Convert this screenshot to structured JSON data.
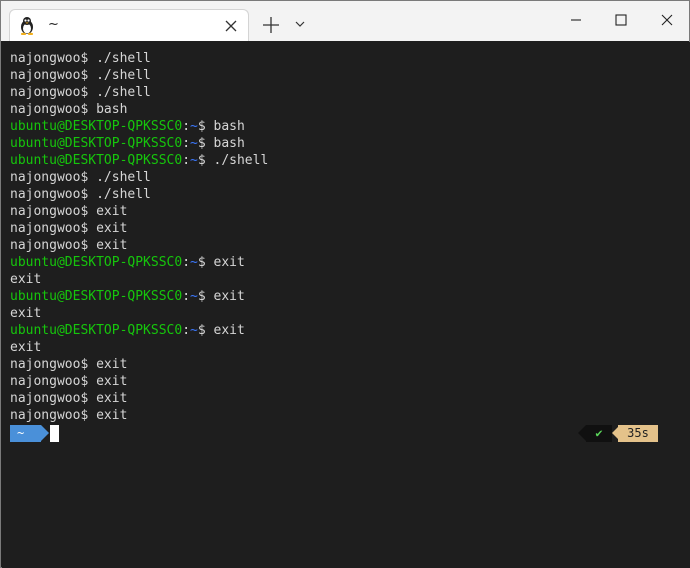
{
  "titlebar": {
    "tab_title": "~",
    "tab_icon": "linux-penguin-icon",
    "new_tab_icon": "plus-icon",
    "dropdown_icon": "chevron-down-icon"
  },
  "terminal": {
    "lines": [
      [
        {
          "text": "najongwoo$ ./shell",
          "c": ""
        }
      ],
      [
        {
          "text": "najongwoo$ ./shell",
          "c": ""
        }
      ],
      [
        {
          "text": "najongwoo$ ./shell",
          "c": ""
        }
      ],
      [
        {
          "text": "najongwoo$ bash",
          "c": ""
        }
      ],
      [
        {
          "text": "ubuntu@DESKTOP-QPKSSC0",
          "c": "green"
        },
        {
          "text": ":",
          "c": ""
        },
        {
          "text": "~",
          "c": "blue"
        },
        {
          "text": "$ bash",
          "c": ""
        }
      ],
      [
        {
          "text": "ubuntu@DESKTOP-QPKSSC0",
          "c": "green"
        },
        {
          "text": ":",
          "c": ""
        },
        {
          "text": "~",
          "c": "blue"
        },
        {
          "text": "$ bash",
          "c": ""
        }
      ],
      [
        {
          "text": "ubuntu@DESKTOP-QPKSSC0",
          "c": "green"
        },
        {
          "text": ":",
          "c": ""
        },
        {
          "text": "~",
          "c": "blue"
        },
        {
          "text": "$ ./shell",
          "c": ""
        }
      ],
      [
        {
          "text": "najongwoo$ ./shell",
          "c": ""
        }
      ],
      [
        {
          "text": "najongwoo$ ./shell",
          "c": ""
        }
      ],
      [
        {
          "text": "najongwoo$ exit",
          "c": ""
        }
      ],
      [
        {
          "text": "najongwoo$ exit",
          "c": ""
        }
      ],
      [
        {
          "text": "najongwoo$ exit",
          "c": ""
        }
      ],
      [
        {
          "text": "ubuntu@DESKTOP-QPKSSC0",
          "c": "green"
        },
        {
          "text": ":",
          "c": ""
        },
        {
          "text": "~",
          "c": "blue"
        },
        {
          "text": "$ exit",
          "c": ""
        }
      ],
      [
        {
          "text": "exit",
          "c": ""
        }
      ],
      [
        {
          "text": "ubuntu@DESKTOP-QPKSSC0",
          "c": "green"
        },
        {
          "text": ":",
          "c": ""
        },
        {
          "text": "~",
          "c": "blue"
        },
        {
          "text": "$ exit",
          "c": ""
        }
      ],
      [
        {
          "text": "exit",
          "c": ""
        }
      ],
      [
        {
          "text": "ubuntu@DESKTOP-QPKSSC0",
          "c": "green"
        },
        {
          "text": ":",
          "c": ""
        },
        {
          "text": "~",
          "c": "blue"
        },
        {
          "text": "$ exit",
          "c": ""
        }
      ],
      [
        {
          "text": "exit",
          "c": ""
        }
      ],
      [
        {
          "text": "najongwoo$ exit",
          "c": ""
        }
      ],
      [
        {
          "text": "najongwoo$ exit",
          "c": ""
        }
      ],
      [
        {
          "text": "najongwoo$ exit",
          "c": ""
        }
      ],
      [
        {
          "text": "najongwoo$ exit",
          "c": ""
        }
      ]
    ],
    "prompt": {
      "path": "~",
      "status": "✔",
      "duration": "35s"
    }
  },
  "colors": {
    "green": "#16c60c",
    "blue": "#3b78ff",
    "path_segment": "#4a90d9",
    "duration_segment": "#e4c28a",
    "background": "#1e1e1e"
  }
}
